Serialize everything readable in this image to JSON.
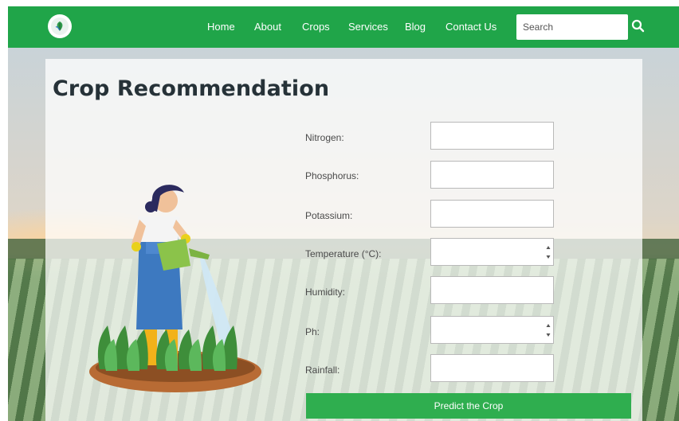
{
  "nav": {
    "links": [
      "Home",
      "About",
      "Crops",
      "Services",
      "Blog",
      "Contact Us"
    ],
    "search_placeholder": "Search"
  },
  "page": {
    "title": "Crop Recommendation"
  },
  "form": {
    "fields": [
      {
        "label": "Nitrogen:",
        "value": ""
      },
      {
        "label": "Phosphorus:",
        "value": ""
      },
      {
        "label": "Potassium:",
        "value": ""
      },
      {
        "label": "Temperature (°C):",
        "value": ""
      },
      {
        "label": "Humidity:",
        "value": ""
      },
      {
        "label": "Ph:",
        "value": ""
      },
      {
        "label": "Rainfall:",
        "value": ""
      }
    ],
    "submit_label": "Predict the Crop"
  },
  "colors": {
    "brand_green": "#20a549",
    "button_green": "#2fae4f"
  }
}
